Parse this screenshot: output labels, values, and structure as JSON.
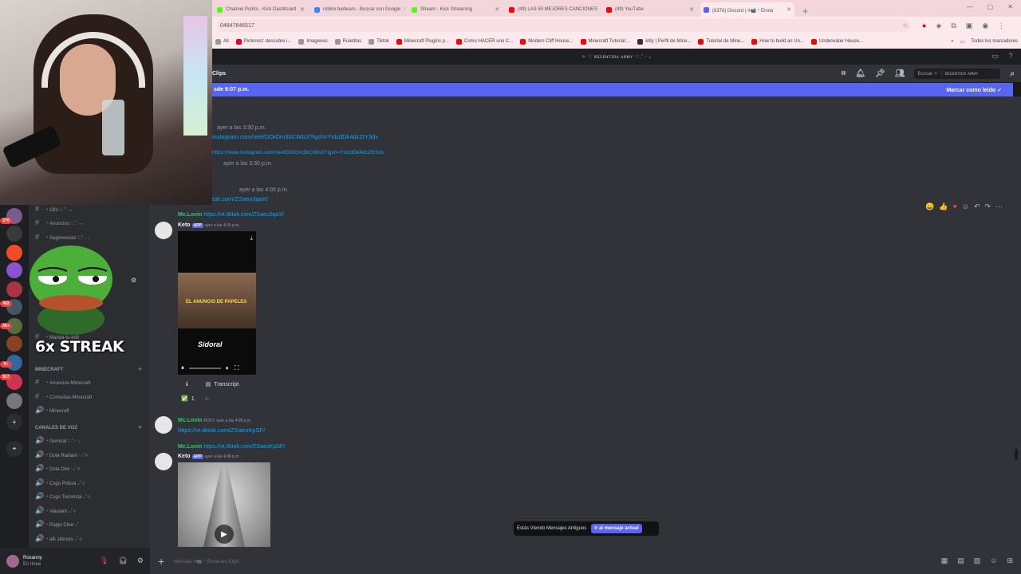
{
  "browser": {
    "tabs": [
      {
        "label": "Channel Points - Kick Dashboard",
        "color": "#53fc18"
      },
      {
        "label": "roblox bedwars - Buscar con Google",
        "color": "#4285f4"
      },
      {
        "label": "Stream - Kick Streaming",
        "color": "#53fc18"
      },
      {
        "label": "(49) LAS 50 MEJORES CANCIONES",
        "color": "#ff0000"
      },
      {
        "label": "(49) YouTube",
        "color": "#ff0000"
      },
      {
        "label": "(8378) Discord | #📹・Envia",
        "color": "#5865f2"
      }
    ],
    "new_tab": "+",
    "url": "04847646517",
    "bookmarks": [
      {
        "label": "All",
        "color": "#999999"
      },
      {
        "label": "Pinterest: descubre i...",
        "color": "#e60023"
      },
      {
        "label": "Imagenes",
        "color": "#999999"
      },
      {
        "label": "Ruletitas",
        "color": "#999999"
      },
      {
        "label": "Tiktok",
        "color": "#999999"
      },
      {
        "label": "Minecraft Plugins p...",
        "color": "#ff0000"
      },
      {
        "label": "Como HACER uno C...",
        "color": "#ff0000"
      },
      {
        "label": "Modern Cliff House...",
        "color": "#ff0000"
      },
      {
        "label": "Minecraft Tutorial:...",
        "color": "#ff0000"
      },
      {
        "label": "kitty | Perfil de Mine...",
        "color": "#333333"
      },
      {
        "label": "Tutorial de Mine...",
        "color": "#ff0000"
      },
      {
        "label": "How to build an Un...",
        "color": "#ff0000"
      },
      {
        "label": "Underwater House...",
        "color": "#ff0000"
      }
    ],
    "all_bookmarks": "Todos los marcadores"
  },
  "discord": {
    "server_title": "✧ ♡ ʀᴇꜱᴇɴᴛɪᴅᴀ ᴀʀᴍʏ ♡.˚ ‧ ₊",
    "channel_title": "Clips",
    "search_placeholder": "Buscar ✧ ♡ ʀᴇꜱᴇɴᴛɪᴅᴀ ᴀʀᴍʏ",
    "new_messages_text": "sde 9:07 p.m.",
    "mark_read": "Marcar como leído",
    "upper_lines": [
      {
        "text": "ayer a las 3:30 p.m."
      },
      {
        "text": "instagram.com/reel/DOrDm3bCWbJ/?igsh=YnlzdDk4dzZtY3dv",
        "link": true
      },
      {
        "text": "https://www.instagram.com/reel/DOrDm3bCWbJ/?igsh=YnlzdDk4dzZtY3dv",
        "link": true
      },
      {
        "text": "ayer a las 3:30 p.m."
      },
      {
        "text": "ayer a las 4:05 p.m."
      },
      {
        "text": "tok.com/ZSaeu3qaX/",
        "link": true
      }
    ],
    "messages": [
      {
        "ref_author": "Mc.Lovin",
        "ref_link": "https://vt.tiktok.com/ZSaeu3qaX/",
        "author": "Keto",
        "tag": "APP",
        "time": "ayer a las 4:05 p.m.",
        "video_caption": "EL ANUNCIO DE PAPELES",
        "video_logo": "Sidoral",
        "transcript": "Transcript",
        "reaction": "✅",
        "reaction_count": "1"
      },
      {
        "author": "Mc.Lovin",
        "tag": "ROXY",
        "time": "ayer a las 4:08 p.m.",
        "link": "https://vt.tiktok.com/ZSaeuKpSF/"
      },
      {
        "ref_author": "Mc.Lovin",
        "ref_link": "https://vt.tiktok.com/ZSaeuKpSF/",
        "author": "Keto",
        "tag": "APP",
        "time": "ayer a las 4:08 p.m."
      }
    ],
    "channels": [
      {
        "label": "・Gifs♡.˚ ‧ ₊",
        "icon": "#"
      },
      {
        "label": "・Anuncios♡.˚ ‧ ₊",
        "icon": "#"
      },
      {
        "label": "・Sugerencias♡.˚ ‧ ₊",
        "icon": "#"
      },
      {
        "label": "・Manda-tu-edit",
        "icon": "#"
      }
    ],
    "categories": {
      "minecraft": "MINECRAFT",
      "voice": "CANALES DE VOZ"
    },
    "minecraft_channels": [
      {
        "label": "・Anuncios-Minecraft",
        "icon": "#"
      },
      {
        "label": "・Consultas-Minecraft",
        "icon": "#"
      },
      {
        "label": "・Minecraft",
        "icon": "🔊"
      }
    ],
    "voice_channels": [
      {
        "label": "・General♡.˚ ‧ ₊"
      },
      {
        "label": "・Dota Radiant ‧₊˚✧"
      },
      {
        "label": "・Dota Dire ‧₊˚✧"
      },
      {
        "label": "・Csgo Policia ₊˚⊹"
      },
      {
        "label": "・Csgo Terrorista ₊˚⊹"
      },
      {
        "label": "・Valorant ₊˚⊹"
      },
      {
        "label": "・Rappi Cine‧₊˚"
      },
      {
        "label": "・afk silencio ₊˚⊹"
      }
    ],
    "server_badges": [
      "276",
      "402",
      "2K+",
      "5+",
      "517"
    ],
    "streak": "6x STREAK",
    "user": {
      "name": "Roxanny",
      "status": "En línea"
    },
    "composer_placeholder": "Mensaje #📹・Envia-tus-Clips",
    "toast_text": "Estás Viendo Mensajes Antiguos",
    "toast_button": "Ir al mensaje actual"
  }
}
